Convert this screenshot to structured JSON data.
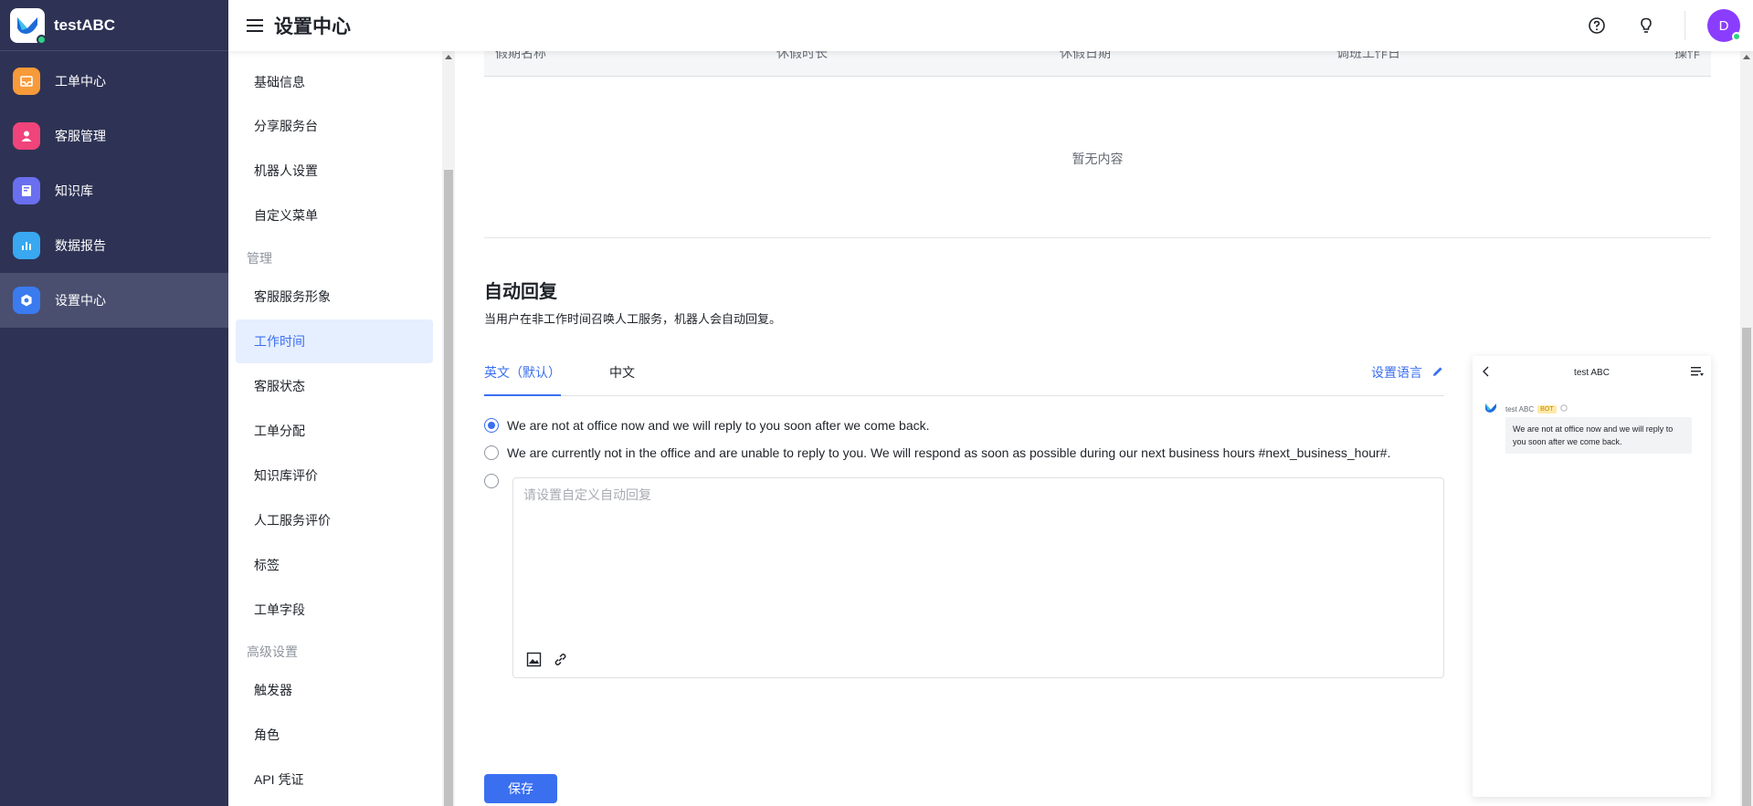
{
  "app": {
    "name": "testABC"
  },
  "nav": [
    {
      "label": "工单中心",
      "icon": "inbox-icon",
      "color": "#f79a39"
    },
    {
      "label": "客服管理",
      "icon": "user-icon",
      "color": "#f0447a"
    },
    {
      "label": "知识库",
      "icon": "book-icon",
      "color": "#6a6ff0"
    },
    {
      "label": "数据报告",
      "icon": "bar-chart-icon",
      "color": "#39a8f0"
    },
    {
      "label": "设置中心",
      "icon": "settings-icon",
      "color": "#3a7bf0"
    }
  ],
  "header": {
    "title": "设置中心",
    "avatar_letter": "D"
  },
  "submenu": {
    "items": [
      "基础信息",
      "分享服务台",
      "机器人设置",
      "自定义菜单"
    ],
    "group_manage": "管理",
    "manage_items": [
      "客服服务形象",
      "工作时间",
      "客服状态",
      "工单分配",
      "知识库评价",
      "人工服务评价",
      "标签",
      "工单字段"
    ],
    "group_advanced": "高级设置",
    "advanced_items": [
      "触发器",
      "角色",
      "API 凭证"
    ]
  },
  "holiday_table": {
    "columns": [
      "假期名称",
      "休假时长",
      "休假日期",
      "调班工作日",
      "操作"
    ],
    "empty_text": "暂无内容"
  },
  "auto_reply": {
    "title": "自动回复",
    "description": "当用户在非工作时间召唤人工服务，机器人会自动回复。",
    "tabs": [
      "英文（默认）",
      "中文"
    ],
    "set_language": "设置语言",
    "options": [
      "We are not at office now and we will reply to you soon after we come back.",
      "We are currently not in the office and are unable to reply to you. We will respond as soon as possible during our next business hours #next_business_hour#."
    ],
    "custom_placeholder": "请设置自定义自动回复",
    "save_label": "保存"
  },
  "preview": {
    "title": "test ABC",
    "sender": "test ABC",
    "bot_badge": "BOT",
    "message": "We are not at office now and we will reply to you soon after we come back."
  }
}
